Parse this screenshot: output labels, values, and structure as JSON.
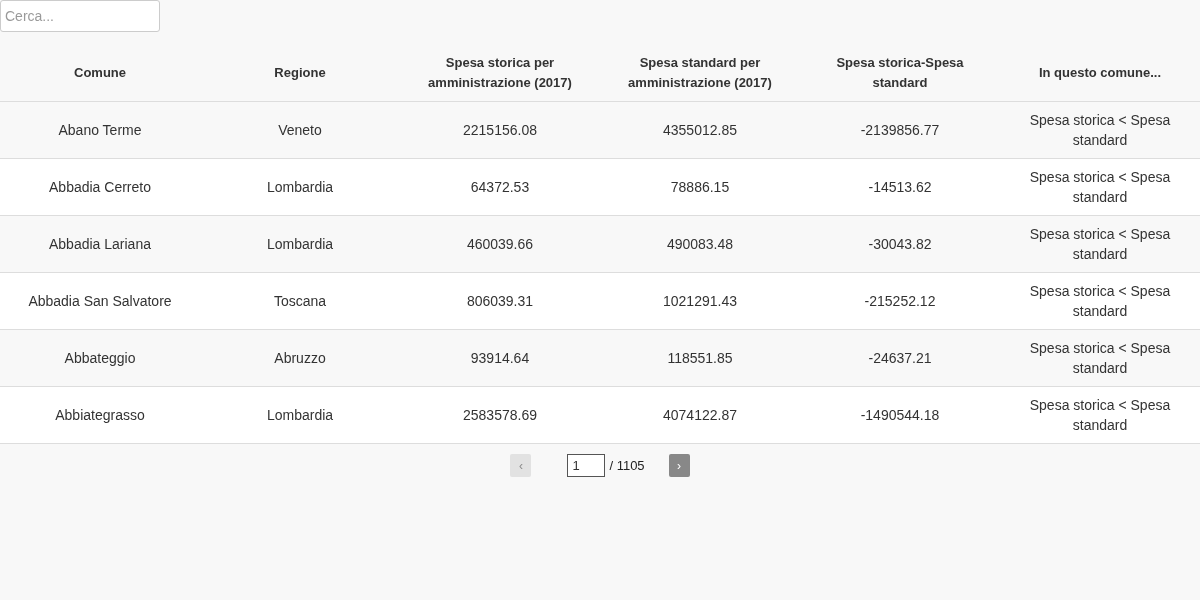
{
  "search": {
    "placeholder": "Cerca..."
  },
  "table": {
    "columns": [
      "Comune",
      "Regione",
      "Spesa storica per amministrazione (2017)",
      "Spesa standard per amministrazione (2017)",
      "Spesa storica-Spesa standard",
      "In questo comune..."
    ],
    "rows": [
      [
        "Abano Terme",
        "Veneto",
        "2215156.08",
        "4355012.85",
        "-2139856.77",
        "Spesa storica < Spesa standard"
      ],
      [
        "Abbadia Cerreto",
        "Lombardia",
        "64372.53",
        "78886.15",
        "-14513.62",
        "Spesa storica < Spesa standard"
      ],
      [
        "Abbadia Lariana",
        "Lombardia",
        "460039.66",
        "490083.48",
        "-30043.82",
        "Spesa storica < Spesa standard"
      ],
      [
        "Abbadia San Salvatore",
        "Toscana",
        "806039.31",
        "1021291.43",
        "-215252.12",
        "Spesa storica < Spesa standard"
      ],
      [
        "Abbateggio",
        "Abruzzo",
        "93914.64",
        "118551.85",
        "-24637.21",
        "Spesa storica < Spesa standard"
      ],
      [
        "Abbiategrasso",
        "Lombardia",
        "2583578.69",
        "4074122.87",
        "-1490544.18",
        "Spesa storica < Spesa standard"
      ]
    ]
  },
  "pagination": {
    "prev": {
      "label": "‹",
      "disabled": true
    },
    "page": "1",
    "total": "/ 1105",
    "next": {
      "label": "›",
      "disabled": false
    }
  }
}
